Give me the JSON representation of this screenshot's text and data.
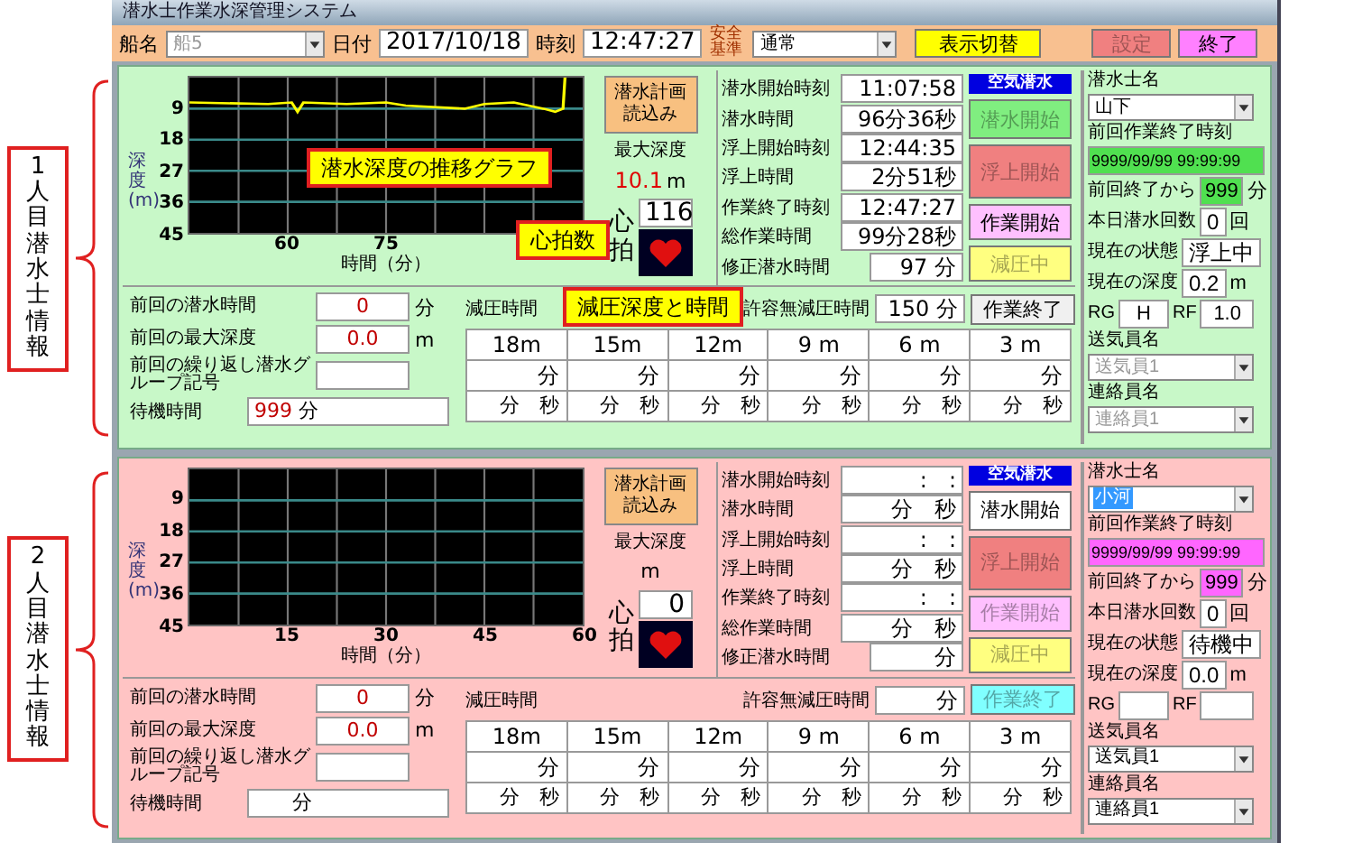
{
  "window": {
    "title": "潜水士作業水深管理システム"
  },
  "toolbar": {
    "ship_label": "船名",
    "ship": {
      "value": "船5",
      "disabled": true
    },
    "date_label": "日付",
    "date": "2017/10/18",
    "time_label": "時刻",
    "time": "12:47:27",
    "safety_label": "安全基準",
    "safety": {
      "value": "通常"
    },
    "buttons": [
      {
        "label": "表示切替",
        "color": "#ffff00",
        "disabled": false
      },
      {
        "label": "設定",
        "color": "#f08080",
        "disabled": true
      },
      {
        "label": "終了",
        "color": "#ff80ff",
        "disabled": false
      }
    ]
  },
  "side_labels": [
    "1人目潜水士情報",
    "2人目潜水士情報"
  ],
  "annotations": [
    "潜水深度の推移グラフ",
    "心拍数",
    "減圧深度と時間"
  ],
  "divers": [
    {
      "color": "#c8f8c8",
      "graph": {
        "y_title": "深度(m)",
        "y_ticks": [
          "9",
          "18",
          "27",
          "36",
          "45"
        ],
        "x_ticks": [
          "60",
          "75"
        ],
        "x_title": "時間（分）",
        "trace_shown": true
      },
      "plan_button": "潜水計画読込み",
      "max_depth_label": "最大深度",
      "max_depth": "10.1",
      "max_depth_unit": "m",
      "heart_label": "心拍",
      "heart_rate": "116",
      "times": [
        {
          "label": "潜水開始時刻",
          "value": "11:07:58"
        },
        {
          "label": "潜水時間",
          "value": "96分36秒"
        },
        {
          "label": "浮上開始時刻",
          "value": "12:44:35"
        },
        {
          "label": "浮上時間",
          "value": "2分51秒"
        },
        {
          "label": "作業終了時刻",
          "value": "12:47:27"
        },
        {
          "label": "総作業時間",
          "value": "99分28秒"
        },
        {
          "label": "修正潜水時間",
          "value": "97 分"
        }
      ],
      "mode": "空気潜水",
      "actions": [
        {
          "label": "潜水開始",
          "color": "#80ee80",
          "disabled": true
        },
        {
          "label": "浮上開始",
          "color": "#f08080",
          "disabled": true
        },
        {
          "label": "作業開始",
          "color": "#ffc0ff",
          "disabled": false
        },
        {
          "label": "減圧中",
          "color": "#ffff80",
          "disabled": true
        }
      ],
      "no_decomp": {
        "label": "許容無減圧時間",
        "value": "150 分"
      },
      "finish_button": {
        "label": "作業終了",
        "color": "#f0f0f0",
        "disabled": false
      },
      "previous": [
        {
          "label": "前回の潜水時間",
          "value": "0",
          "unit": "分"
        },
        {
          "label": "前回の最大深度",
          "value": "0.0",
          "unit": "m"
        },
        {
          "label": "前回の繰り返し潜水グループ記号"
        }
      ],
      "wait": {
        "label": "待機時間",
        "value": "999",
        "unit": "分"
      },
      "decompression": {
        "title": "減圧時間",
        "depths": [
          "18m",
          "15m",
          "12m",
          "9 m",
          "6 m",
          "3 m"
        ],
        "minutes": [
          "分",
          "分",
          "分",
          "分",
          "分",
          "分"
        ],
        "min_sec": [
          "分　秒",
          "分　秒",
          "分　秒",
          "分　秒",
          "分　秒",
          "分　秒"
        ]
      },
      "diver_name_label": "潜水士名",
      "diver_name": {
        "value": "山下",
        "highlighted": false
      },
      "last_end_label": "前回作業終了時刻",
      "last_end": {
        "value": "9999/99/99 99:99:99",
        "color": "#50e050"
      },
      "since": {
        "label": "前回終了から",
        "value": "999",
        "unit": "分",
        "color": "#50e050"
      },
      "dives_today": {
        "label": "本日潜水回数",
        "value": "0",
        "unit": "回"
      },
      "state": {
        "label": "現在の状態",
        "value": "浮上中"
      },
      "depth": {
        "label": "現在の深度",
        "value": "0.2",
        "unit": "m"
      },
      "rg": {
        "label": "RG",
        "value": "H"
      },
      "rf": {
        "label": "RF",
        "value": "1.0"
      },
      "tender": {
        "label": "送気員名",
        "value": "送気員1",
        "disabled": true
      },
      "contact": {
        "label": "連絡員名",
        "value": "連絡員1",
        "disabled": true
      }
    },
    {
      "color": "#ffc4c4",
      "graph": {
        "y_title": "深度(m)",
        "y_ticks": [
          "9",
          "18",
          "27",
          "36",
          "45"
        ],
        "x_ticks": [
          "15",
          "30",
          "45",
          "60"
        ],
        "x_title": "時間（分）",
        "trace_shown": false
      },
      "plan_button": "潜水計画読込み",
      "max_depth_label": "最大深度",
      "max_depth_unit": "m",
      "heart_label": "心拍",
      "heart_rate": "0",
      "times": [
        {
          "label": "潜水開始時刻",
          "value": ":　:"
        },
        {
          "label": "潜水時間",
          "value": "分　秒"
        },
        {
          "label": "浮上開始時刻",
          "value": ":　:"
        },
        {
          "label": "浮上時間",
          "value": "分　秒"
        },
        {
          "label": "作業終了時刻",
          "value": ":　:"
        },
        {
          "label": "総作業時間",
          "value": "分　秒"
        },
        {
          "label": "修正潜水時間",
          "value": "分"
        }
      ],
      "mode": "空気潜水",
      "actions": [
        {
          "label": "潜水開始",
          "color": "#ffffff",
          "disabled": false
        },
        {
          "label": "浮上開始",
          "color": "#f08080",
          "disabled": true
        },
        {
          "label": "作業開始",
          "color": "#ffc0ff",
          "disabled": true
        },
        {
          "label": "減圧中",
          "color": "#ffff80",
          "disabled": true
        }
      ],
      "no_decomp": {
        "label": "許容無減圧時間",
        "value": "分"
      },
      "finish_button": {
        "label": "作業終了",
        "color": "#80ffff",
        "disabled": true
      },
      "previous": [
        {
          "label": "前回の潜水時間",
          "value": "0",
          "unit": "分"
        },
        {
          "label": "前回の最大深度",
          "value": "0.0",
          "unit": "m"
        },
        {
          "label": "前回の繰り返し潜水グループ記号"
        }
      ],
      "wait": {
        "label": "待機時間",
        "unit": "分"
      },
      "decompression": {
        "title": "減圧時間",
        "depths": [
          "18m",
          "15m",
          "12m",
          "9 m",
          "6 m",
          "3 m"
        ],
        "minutes": [
          "分",
          "分",
          "分",
          "分",
          "分",
          "分"
        ],
        "min_sec": [
          "分　秒",
          "分　秒",
          "分　秒",
          "分　秒",
          "分　秒",
          "分　秒"
        ]
      },
      "diver_name_label": "潜水士名",
      "diver_name": {
        "value": "小河",
        "highlighted": true
      },
      "last_end_label": "前回作業終了時刻",
      "last_end": {
        "value": "9999/99/99 99:99:99",
        "color": "#ff66ff"
      },
      "since": {
        "label": "前回終了から",
        "value": "999",
        "unit": "分",
        "color": "#ff66ff"
      },
      "dives_today": {
        "label": "本日潜水回数",
        "value": "0",
        "unit": "回"
      },
      "state": {
        "label": "現在の状態",
        "value": "待機中"
      },
      "depth": {
        "label": "現在の深度",
        "value": "0.0",
        "unit": "m"
      },
      "rg": {
        "label": "RG"
      },
      "rf": {
        "label": "RF"
      },
      "tender": {
        "label": "送気員名",
        "value": "送気員1",
        "disabled": false
      },
      "contact": {
        "label": "連絡員名",
        "value": "連絡員1",
        "disabled": false
      }
    }
  ]
}
